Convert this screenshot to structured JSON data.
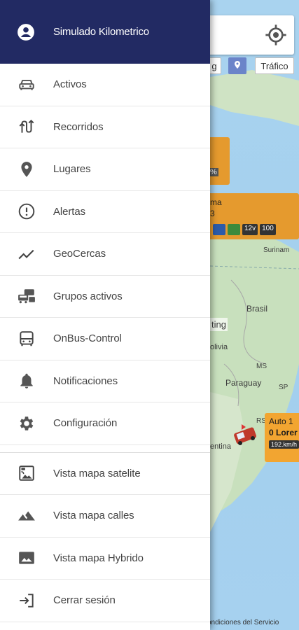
{
  "drawer": {
    "header": {
      "title": "Simulado Kilometrico",
      "icon": "account-circle-icon",
      "background": "#222a63"
    },
    "items": [
      {
        "label": "Activos",
        "icon": "car-icon"
      },
      {
        "label": "Recorridos",
        "icon": "routes-icon"
      },
      {
        "label": "Lugares",
        "icon": "location-pin-icon"
      },
      {
        "label": "Alertas",
        "icon": "alert-circle-icon"
      },
      {
        "label": "GeoCercas",
        "icon": "trending-line-icon"
      },
      {
        "label": "Grupos activos",
        "icon": "vehicle-group-icon"
      },
      {
        "label": "OnBus-Control",
        "icon": "bus-icon"
      },
      {
        "label": "Notificaciones",
        "icon": "bell-icon"
      },
      {
        "label": "Configuración",
        "icon": "gear-icon"
      }
    ],
    "map_items": [
      {
        "label": "Vista mapa satelite",
        "icon": "satellite-image-icon"
      },
      {
        "label": "Vista mapa calles",
        "icon": "terrain-icon"
      },
      {
        "label": "Vista mapa Hybrido",
        "icon": "image-icon"
      },
      {
        "label": "Cerrar sesión",
        "icon": "logout-icon"
      }
    ]
  },
  "map": {
    "traffic_label": "Tráfico",
    "partial_chip_label": "g",
    "card_partial_top": "%",
    "card_partial_name": "ma",
    "card_partial_sub": "3",
    "card_partial_battery_label": "12v",
    "card_partial_percent": "100",
    "labels": {
      "suriname": "Surinam",
      "brasil": "Brasil",
      "bolivia": "olivia",
      "paraguay": "Paraguay",
      "ms": "MS",
      "sp": "SP",
      "rs": "RS",
      "argentina": "entina",
      "ting": "ting"
    },
    "vehicle": {
      "line1": "Auto 1",
      "line2": "0 Lorer",
      "speed": "192.km/h"
    },
    "footer": "ondiciones del Servicio"
  }
}
